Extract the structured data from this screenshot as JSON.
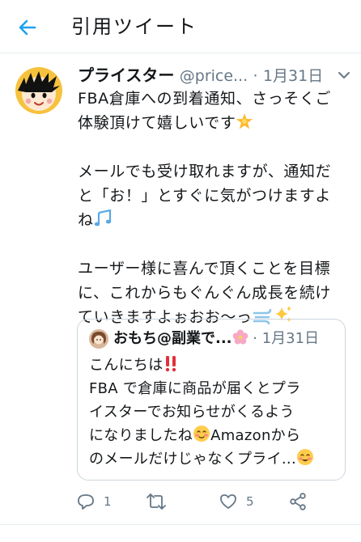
{
  "header": {
    "title": "引用ツイート",
    "back_icon": "arrow-left-icon",
    "accent": "#1da1f2"
  },
  "tweet": {
    "author_name": "プライスター",
    "author_handle": "@price...",
    "separator": "·",
    "date": "1月31日",
    "lines": [
      "FBA倉庫への到着通知、さっそくご",
      "体験頂けて嬉しいです",
      "メールでも受け取れますが、通知だ",
      "と「お！」とすぐに気がつけますよ",
      "ね",
      "ユーザー様に喜んで頂くことを目標",
      "に、これからもぐんぐん成長を続け",
      "ていきますよぉおお〜っ"
    ],
    "emojis": [
      "star-sparkle-emoji",
      "musical-notes-emoji",
      "dash-emoji",
      "sparkles-emoji"
    ]
  },
  "quoted": {
    "author_name": "おもち@副業で...",
    "date": "1月31日",
    "lines": [
      "こんにちは",
      "FBA で倉庫に商品が届くとプラ",
      "イスターでお知らせがくるよう",
      "になりましたね",
      "Amazonから",
      "のメールだけじゃなくプライ..."
    ],
    "emojis": [
      "double-exclamation-emoji",
      "blush-emoji",
      "smile-emoji",
      "cherry-blossom-emoji"
    ]
  },
  "actions": {
    "reply_count": "1",
    "retweet_count": "",
    "like_count": "5",
    "icons": [
      "reply-icon",
      "retweet-icon",
      "like-icon",
      "share-icon"
    ]
  },
  "colors": {
    "text": "#14171a",
    "secondary": "#657786",
    "border": "#ccd6dd",
    "accent": "#1da1f2"
  }
}
